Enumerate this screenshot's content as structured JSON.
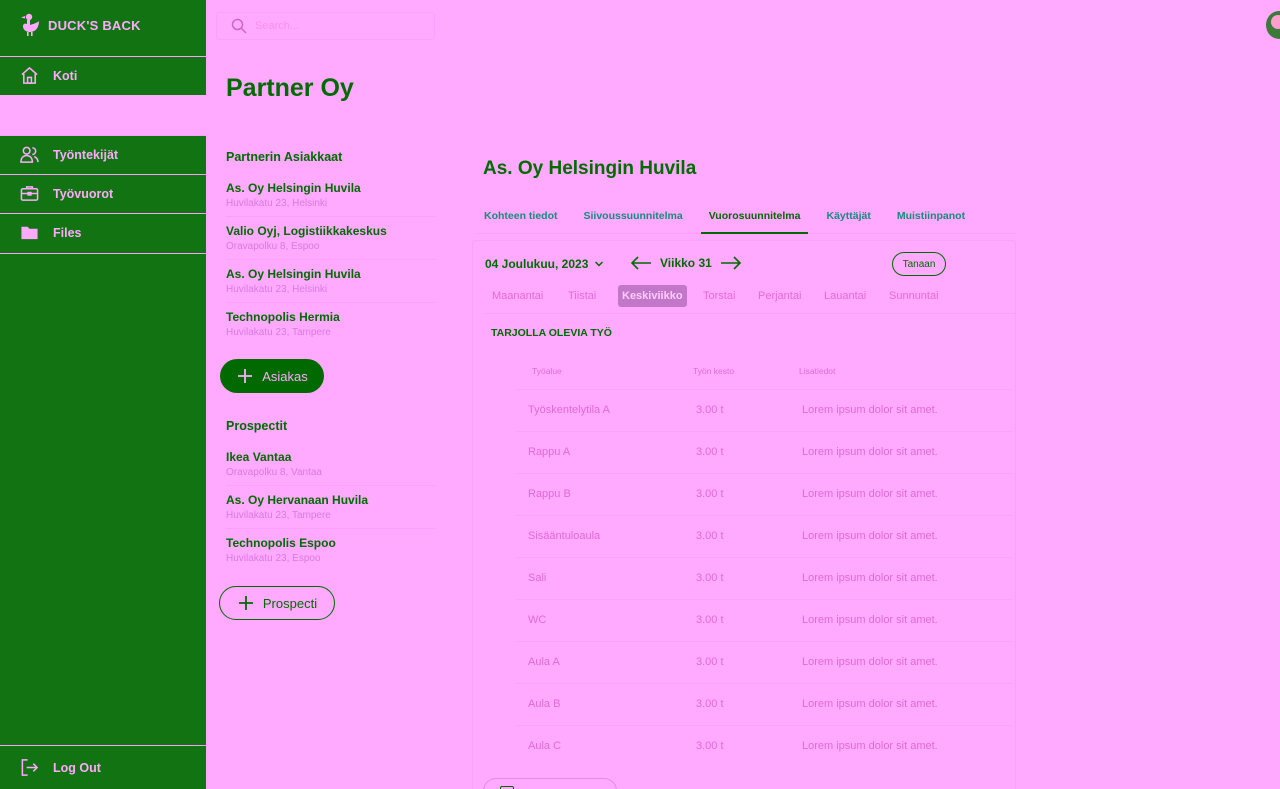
{
  "brand": {
    "name": "DUCK'S BACK"
  },
  "nav": {
    "home": "Koti",
    "employees": "Työntekijät",
    "shifts": "Työvuorot",
    "files": "Files",
    "logout": "Log Out"
  },
  "search": {
    "placeholder": "Search..."
  },
  "page_title": "Partner Oy",
  "clients": {
    "title": "Partnerin Asiakkaat",
    "items": [
      {
        "name": "As. Oy Helsingin Huvila",
        "address": "Huvilakatu 23, Helsinki"
      },
      {
        "name": "Valio Oyj, Logistiikkakeskus",
        "address": "Oravapolku 8, Espoo"
      },
      {
        "name": "As. Oy Helsingin Huvila",
        "address": "Huvilakatu 23, Helsinki"
      },
      {
        "name": "Technopolis Hermia",
        "address": "Huvilakatu 23, Tampere"
      }
    ],
    "add_label": "Asiakas"
  },
  "prospects": {
    "title": "Prospectit",
    "items": [
      {
        "name": "Ikea Vantaa",
        "address": "Oravapolku 8, Vantaa"
      },
      {
        "name": "As. Oy Hervanaan Huvila",
        "address": "Huvilakatu 23, Tampere"
      },
      {
        "name": "Technopolis Espoo",
        "address": "Huvilakatu 23, Espoo"
      }
    ],
    "add_label": "Prospecti"
  },
  "detail": {
    "title": "As. Oy Helsingin Huvila",
    "tabs": [
      "Kohteen tiedot",
      "Siivoussuunnitelma",
      "Vuorosuunnitelma",
      "Käyttäjät",
      "Muistiinpanot"
    ],
    "active_tab": "Vuorosuunnitelma",
    "date": "04 Joulukuu, 2023",
    "week": "Viikko 31",
    "today_label": "Tanaan",
    "days": [
      "Maanantai",
      "Tiistai",
      "Keskiviikko",
      "Torstai",
      "Perjantai",
      "Lauantai",
      "Sunnuntai"
    ],
    "active_day": "Keskiviikko",
    "offer_title": "TARJOLLA OLEVIA TYÖ",
    "columns": {
      "area": "Työalue",
      "duration": "Työn kesto",
      "info": "Lisatiedot"
    },
    "rows": [
      {
        "area": "Työskentelytila A",
        "duration": "3.00 t",
        "info": "Lorem ipsum dolor sit amet."
      },
      {
        "area": "Rappu A",
        "duration": "3.00 t",
        "info": "Lorem ipsum dolor sit amet."
      },
      {
        "area": "Rappu B",
        "duration": "3.00 t",
        "info": "Lorem ipsum dolor sit amet."
      },
      {
        "area": "Sisääntuloaula",
        "duration": "3.00 t",
        "info": "Lorem ipsum dolor sit amet."
      },
      {
        "area": "Sali",
        "duration": "3.00 t",
        "info": "Lorem ipsum dolor sit amet."
      },
      {
        "area": "WC",
        "duration": "3.00 t",
        "info": "Lorem ipsum dolor sit amet."
      },
      {
        "area": "Aula A",
        "duration": "3.00 t",
        "info": "Lorem ipsum dolor sit amet."
      },
      {
        "area": "Aula B",
        "duration": "3.00 t",
        "info": "Lorem ipsum dolor sit amet."
      },
      {
        "area": "Aula C",
        "duration": "3.00 t",
        "info": "Lorem ipsum dolor sit amet."
      }
    ]
  },
  "colors": {
    "background": "#ffaaff",
    "sidebar": "#117311",
    "primary": "#006a00",
    "muted_text": "#e06ad6"
  }
}
